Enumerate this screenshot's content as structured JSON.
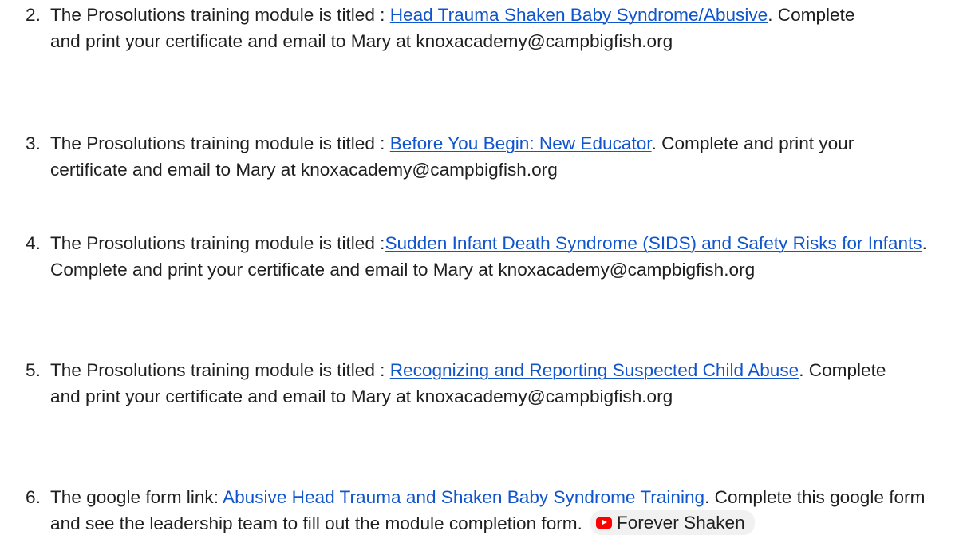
{
  "items": [
    {
      "number": "2.",
      "prefix": "The Prosolutions training module is titled : ",
      "link": "Head Trauma Shaken Baby Syndrome/Abusive",
      "suffix": ". Complete and print your certificate and email to Mary at knoxacademy@campbigfish.org"
    },
    {
      "number": "3.",
      "prefix": "The Prosolutions training module is titled : ",
      "link": "Before You Begin: New Educator",
      "suffix": ". Complete and print your certificate and email to Mary at knoxacademy@campbigfish.org"
    },
    {
      "number": "4.",
      "prefix": "The Prosolutions training module is titled :",
      "link": "Sudden Infant Death Syndrome (SIDS) and Safety Risks for Infants",
      "suffix": ". Complete and print your certificate and email to Mary at knoxacademy@campbigfish.org"
    },
    {
      "number": "5.",
      "prefix": "The Prosolutions training module is titled : ",
      "link": "Recognizing and Reporting Suspected Child Abuse",
      "suffix": ". Complete and print your certificate and email to Mary at knoxacademy@campbigfish.org"
    },
    {
      "number": "6.",
      "prefix": "The google form link: ",
      "link": "Abusive Head Trauma and Shaken Baby Syndrome Training",
      "suffix": ". Complete this google form and see the leadership team to fill out the module completion form.",
      "chip": {
        "label": "Forever Shaken",
        "icon": "youtube-icon"
      }
    }
  ],
  "colors": {
    "text": "#1f1f1f",
    "link": "#1155cc",
    "chip_background": "#f1f1f1",
    "youtube_red": "#ff0000"
  }
}
